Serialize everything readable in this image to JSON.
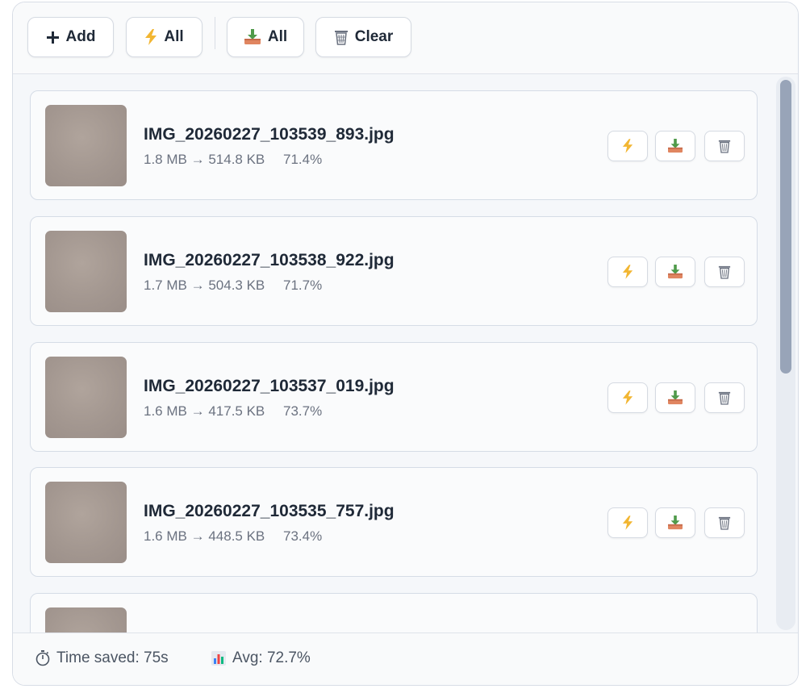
{
  "toolbar": {
    "add_label": "Add",
    "compress_all_label": "All",
    "download_all_label": "All",
    "clear_label": "Clear"
  },
  "files": [
    {
      "name": "IMG_20260227_103539_893.jpg",
      "original": "1.8 MB",
      "arrow": "→",
      "compressed": "514.8 KB",
      "saving": "71.4%"
    },
    {
      "name": "IMG_20260227_103538_922.jpg",
      "original": "1.7 MB",
      "arrow": "→",
      "compressed": "504.3 KB",
      "saving": "71.7%"
    },
    {
      "name": "IMG_20260227_103537_019.jpg",
      "original": "1.6 MB",
      "arrow": "→",
      "compressed": "417.5 KB",
      "saving": "73.7%"
    },
    {
      "name": "IMG_20260227_103535_757.jpg",
      "original": "1.6 MB",
      "arrow": "→",
      "compressed": "448.5 KB",
      "saving": "73.4%"
    }
  ],
  "footer": {
    "time_saved": "Time saved: 75s",
    "avg": "Avg: 72.7%"
  },
  "colors": {
    "accent_bolt": "#f2b632",
    "download_green": "#4f9a4a",
    "download_tray": "#e08560"
  },
  "icons": [
    "plus-icon",
    "bolt-icon",
    "download-icon",
    "trash-icon",
    "stopwatch-icon",
    "bar-chart-icon"
  ]
}
